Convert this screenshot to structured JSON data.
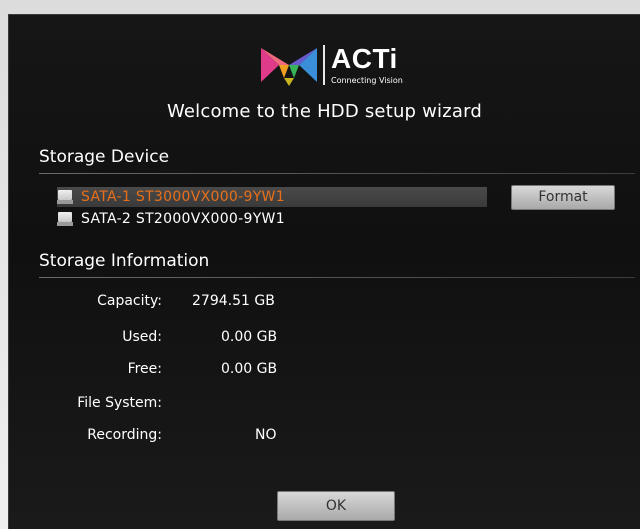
{
  "brand": {
    "name": "ACTi",
    "tagline": "Connecting Vision"
  },
  "welcome": "Welcome to the HDD setup wizard",
  "storage_device": {
    "title": "Storage Device",
    "devices": [
      {
        "label": "SATA-1 ST3000VX000-9YW1",
        "selected": true,
        "icon": "hard-disk-icon"
      },
      {
        "label": "SATA-2 ST2000VX000-9YW1",
        "selected": false,
        "icon": "hard-disk-icon"
      }
    ],
    "format_label": "Format"
  },
  "storage_information": {
    "title": "Storage Information",
    "capacity_label": "Capacity:",
    "capacity_value": "2794.51 GB",
    "used_label": "Used:",
    "used_value": "0.00 GB",
    "free_label": "Free:",
    "free_value": "0.00 GB",
    "filesystem_label": "File System:",
    "filesystem_value": "",
    "recording_label": "Recording:",
    "recording_value": "NO"
  },
  "ok_label": "OK",
  "colors": {
    "selected_text": "#e8701a",
    "background": "#121212"
  }
}
